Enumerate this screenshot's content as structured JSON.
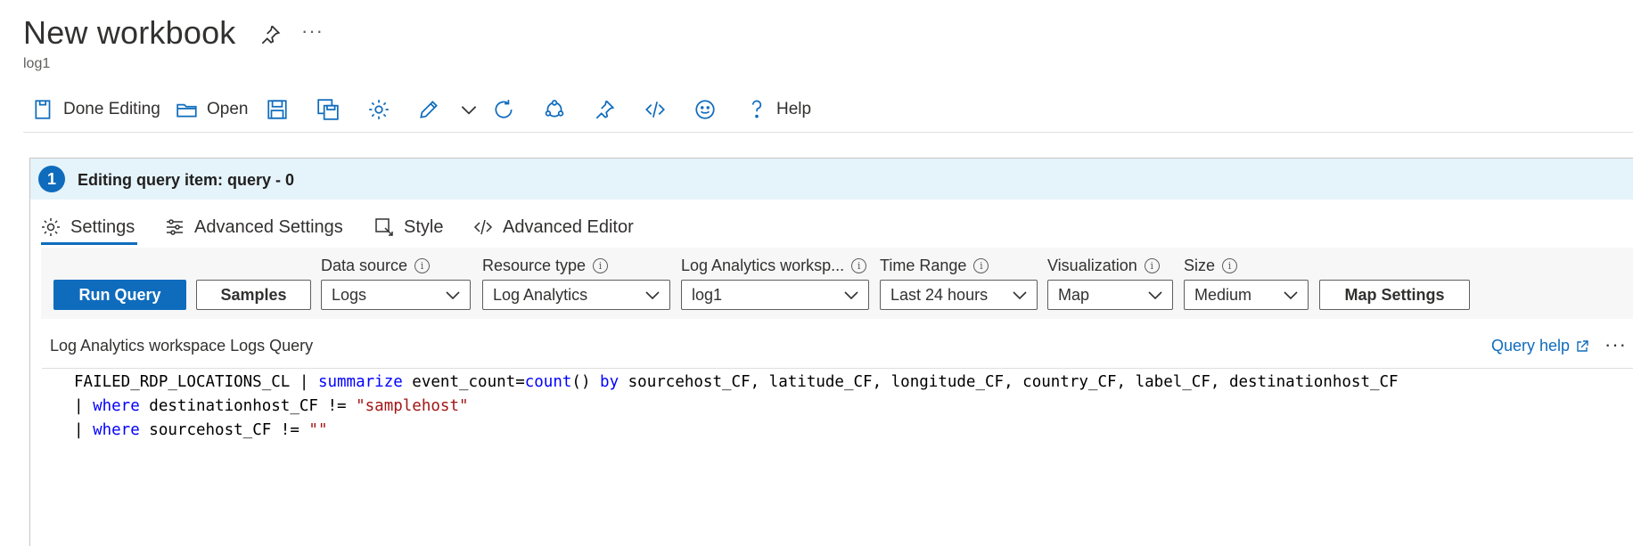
{
  "header": {
    "title": "New workbook",
    "subtitle": "log1",
    "more_label": "···"
  },
  "toolbar": {
    "done_editing": "Done Editing",
    "open": "Open",
    "help": "Help"
  },
  "editor": {
    "step_number": "1",
    "title": "Editing query item: query - 0",
    "tabs": [
      {
        "label": "Settings",
        "selected": true
      },
      {
        "label": "Advanced Settings",
        "selected": false
      },
      {
        "label": "Style",
        "selected": false
      },
      {
        "label": "Advanced Editor",
        "selected": false
      }
    ]
  },
  "controls": {
    "run_query": "Run Query",
    "samples": "Samples",
    "map_settings": "Map Settings",
    "data_source": {
      "label": "Data source",
      "value": "Logs"
    },
    "resource_type": {
      "label": "Resource type",
      "value": "Log Analytics"
    },
    "workspace": {
      "label": "Log Analytics worksp...",
      "value": "log1"
    },
    "time_range": {
      "label": "Time Range",
      "value": "Last 24 hours"
    },
    "visualization": {
      "label": "Visualization",
      "value": "Map"
    },
    "size": {
      "label": "Size",
      "value": "Medium"
    }
  },
  "query": {
    "title": "Log Analytics workspace Logs Query",
    "help": "Query help",
    "more_label": "···",
    "line1": {
      "a": "FAILED_RDP_LOCATIONS_CL | ",
      "kw_summarize": "summarize",
      "b": " event_count=",
      "fn_count": "count",
      "c": "() ",
      "kw_by": "by",
      "d": " sourcehost_CF, latitude_CF, longitude_CF, country_CF, label_CF, destinationhost_CF"
    },
    "line2": {
      "pipe": "| ",
      "kw_where": "where",
      "body": " destinationhost_CF != ",
      "str": "\"samplehost\""
    },
    "line3": {
      "pipe": "| ",
      "kw_where": "where",
      "body": " sourcehost_CF != ",
      "str": "\"\""
    }
  },
  "colors": {
    "accent": "#0f6cbd",
    "panel_header_bg": "#e5f3fb",
    "keyword": "#0000ff",
    "string": "#a31515"
  }
}
